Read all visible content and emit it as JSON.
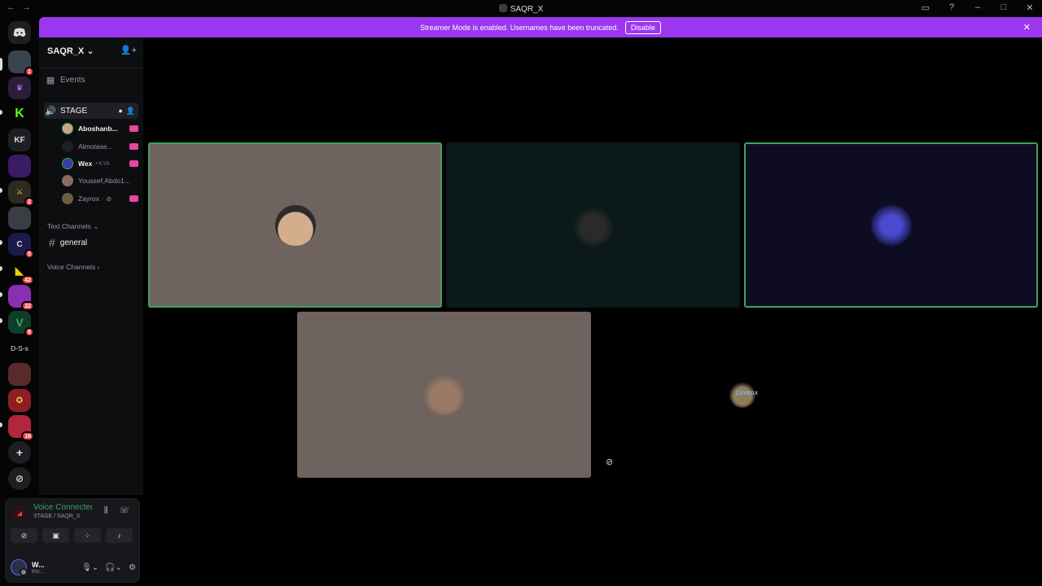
{
  "window": {
    "title": "SAQR_X",
    "nav_back": "←",
    "nav_forward": "→"
  },
  "titlebar_icons": [
    "inbox-icon",
    "help-icon",
    "minimize-icon",
    "maximize-icon",
    "close-icon"
  ],
  "banner": {
    "text": "Streamer Mode is enabled. Usernames have been truncated.",
    "button": "Disable",
    "close": "✕"
  },
  "guilds": [
    {
      "name": "discord-home",
      "label": "",
      "badge": ""
    },
    {
      "name": "server-1",
      "label": "",
      "badge": "1"
    },
    {
      "name": "server-2",
      "label": "",
      "badge": ""
    },
    {
      "name": "server-kick",
      "label": "K",
      "badge": ""
    },
    {
      "name": "server-kf",
      "label": "KF",
      "badge": ""
    },
    {
      "name": "server-5",
      "label": "",
      "badge": ""
    },
    {
      "name": "server-6",
      "label": "",
      "badge": "2"
    },
    {
      "name": "server-7",
      "label": "",
      "badge": ""
    },
    {
      "name": "server-8",
      "label": "",
      "badge": "5"
    },
    {
      "name": "server-9",
      "label": "",
      "badge": "42"
    },
    {
      "name": "server-10",
      "label": "",
      "badge": "22"
    },
    {
      "name": "server-11",
      "label": "",
      "badge": "8"
    },
    {
      "name": "server-dss",
      "label": "D-S-s",
      "badge": ""
    },
    {
      "name": "server-13",
      "label": "",
      "badge": ""
    },
    {
      "name": "server-14",
      "label": "",
      "badge": ""
    },
    {
      "name": "server-15",
      "label": "",
      "badge": "16"
    },
    {
      "name": "add-server",
      "label": "+",
      "badge": ""
    },
    {
      "name": "discover",
      "label": "⊘",
      "badge": ""
    }
  ],
  "sidebar": {
    "server_name": "SAQR_X",
    "events": "Events",
    "stage_channel": "STAGE",
    "members": [
      {
        "name": "Aboshanb...",
        "bright": true,
        "extra": ""
      },
      {
        "name": "Almotase...",
        "bright": false,
        "extra": ""
      },
      {
        "name": "Wex",
        "bright": true,
        "extra": "⚡KYA"
      },
      {
        "name": "Youssef,Abdo1...",
        "bright": false,
        "extra": ""
      },
      {
        "name": "Zayrox",
        "bright": false,
        "extra": "·"
      }
    ],
    "text_category": "Text Channels",
    "text_channel": "general",
    "voice_category": "Voice Channels"
  },
  "voice_panel": {
    "status": "Voice Connected",
    "location": "STAGE / SAQR_X",
    "user_name": "W...",
    "user_status": "Inv..."
  },
  "stage_tiles": [
    {
      "name": "tile-aboshanb",
      "bg": "#6f6360",
      "speaking": true,
      "face": "#c8a58a"
    },
    {
      "name": "tile-almotase",
      "bg": "#0b1919",
      "speaking": false,
      "face": "#1c2222"
    },
    {
      "name": "tile-wex",
      "bg": "#0e0c22",
      "speaking": true,
      "face": "#3a3aa8"
    },
    {
      "name": "tile-youssef",
      "bg": "#6f6360",
      "speaking": false,
      "face": "#8a6c5d"
    },
    {
      "name": "tile-zayrox",
      "bg": "#000000",
      "speaking": false,
      "face": "#6b5d45"
    }
  ],
  "zayrox_label": "ZAYROX"
}
